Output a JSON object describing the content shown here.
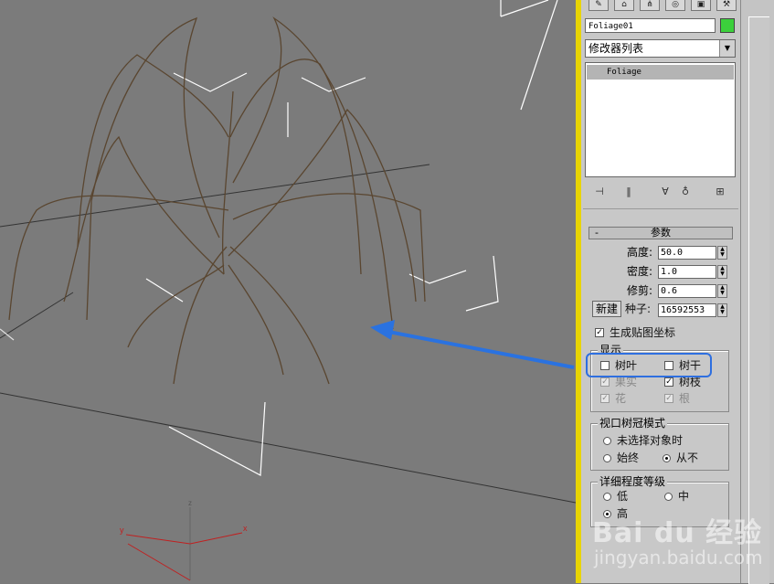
{
  "object": {
    "name": "Foliage01",
    "color": "#3cd03c"
  },
  "modifier_list": {
    "label": "修改器列表"
  },
  "stack": {
    "items": [
      "Foliage"
    ]
  },
  "rollout": {
    "title": "参数",
    "collapse_symbol": "-"
  },
  "params": {
    "height_label": "高度:",
    "height_value": "50.0",
    "density_label": "密度:",
    "density_value": "1.0",
    "prune_label": "修剪:",
    "prune_value": "0.6",
    "new_label": "新建",
    "seed_label": "种子:",
    "seed_value": "16592553",
    "gen_mapping_label": "生成贴图坐标"
  },
  "display": {
    "title": "显示",
    "leaves": "树叶",
    "trunk": "树干",
    "fruit": "果实",
    "branches": "树枝",
    "flowers": "花",
    "roots": "根"
  },
  "canopy": {
    "title": "视口树冠模式",
    "when_unselected": "未选择对象时",
    "always": "始终",
    "never": "从不"
  },
  "detail": {
    "title": "详细程度等级",
    "low": "低",
    "medium": "中",
    "high": "高"
  },
  "axis": {
    "x": "x",
    "y": "y",
    "z": "z"
  },
  "watermark": {
    "logo": "Bai du 经验",
    "url": "jingyan.baidu.com"
  },
  "colors": {
    "panel_border": "#e8d400",
    "highlight": "#2e6fe0",
    "arrow": "#2a72e0",
    "selection": "#b4b4b4"
  }
}
